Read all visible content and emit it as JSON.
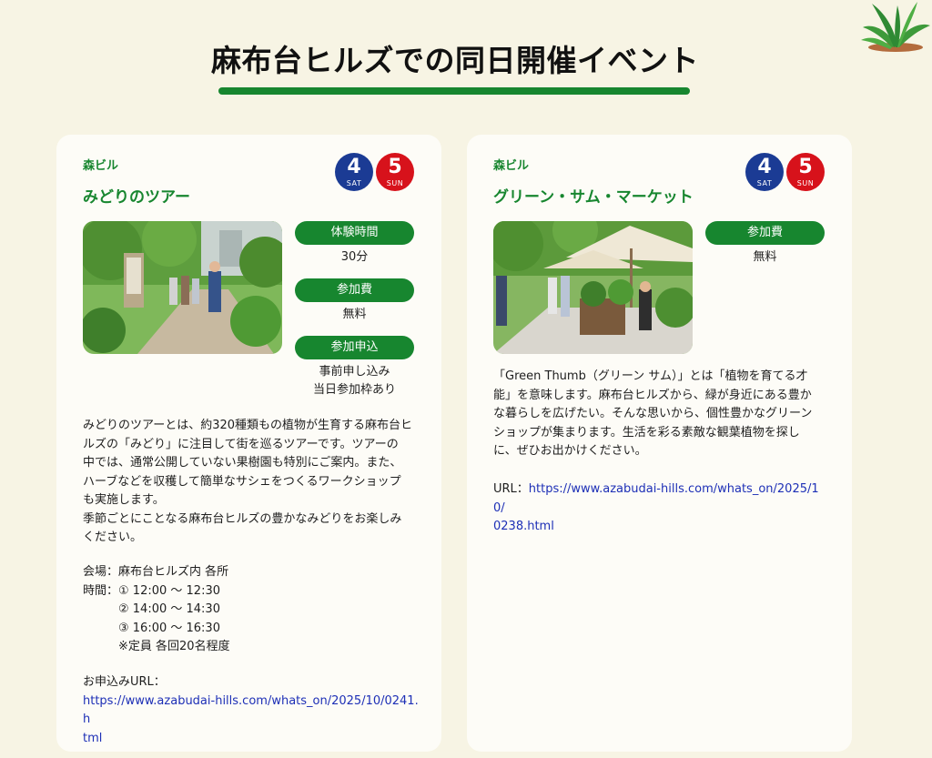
{
  "section": {
    "title": "麻布台ヒルズでの同日開催イベント"
  },
  "events": [
    {
      "venue": "森ビル",
      "title": "みどりのツアー",
      "dates": [
        {
          "num": "4",
          "dow": "SAT",
          "color": "#1b3b94"
        },
        {
          "num": "5",
          "dow": "SUN",
          "color": "#d7121b"
        }
      ],
      "info": [
        {
          "label": "体験時間",
          "value": "30分"
        },
        {
          "label": "参加費",
          "value": "無料"
        },
        {
          "label": "参加申込",
          "value_line1": "事前申し込み",
          "value_line2": "当日参加枠あり"
        }
      ],
      "description_lines": [
        "みどりのツアーとは、約320種類もの植物が生育する麻布台ヒ",
        "ルズの「みどり」に注目して街を巡るツアーです。ツアーの",
        "中では、通常公開していない果樹園も特別にご案内。また、",
        "ハーブなどを収穫して簡単なサシェをつくるワークショップ",
        "も実施します。",
        "季節ごとにことなる麻布台ヒルズの豊かなみどりをお楽しみ",
        "ください。"
      ],
      "venue_line": "会場：麻布台ヒルズ内 各所",
      "time_label": "時間：",
      "times": [
        "① 12:00 〜 12:30",
        "② 14:00 〜 14:30",
        "③ 16:00 〜 16:30"
      ],
      "capacity": "※定員 各回20名程度",
      "url_label": "お申込みURL：",
      "url_line1": "https://www.azabudai-hills.com/whats_on/2025/10/0241.h",
      "url_line2": "tml"
    },
    {
      "venue": "森ビル",
      "title": "グリーン・サム・マーケット",
      "dates": [
        {
          "num": "4",
          "dow": "SAT",
          "color": "#1b3b94"
        },
        {
          "num": "5",
          "dow": "SUN",
          "color": "#d7121b"
        }
      ],
      "info": [
        {
          "label": "参加費",
          "value": "無料"
        }
      ],
      "description_lines": [
        "「Green Thumb（グリーン サム）」とは「植物を育てる才",
        "能」を意味します。麻布台ヒルズから、緑が身近にある豊か",
        "な暮らしを広げたい。そんな思いから、個性豊かなグリーン",
        "ショップが集まります。生活を彩る素敵な観葉植物を探し",
        "に、ぜひお出かけください。"
      ],
      "url_label": "URL：",
      "url_line1": "https://www.azabudai-hills.com/whats_on/2025/10/",
      "url_line2": "0238.html"
    }
  ],
  "colors": {
    "background": "#f7f4e4",
    "card": "#fdfcf7",
    "accent_green": "#17862f",
    "link_blue": "#1d2fb6"
  },
  "icons": {
    "decoration": "plant-icon"
  }
}
